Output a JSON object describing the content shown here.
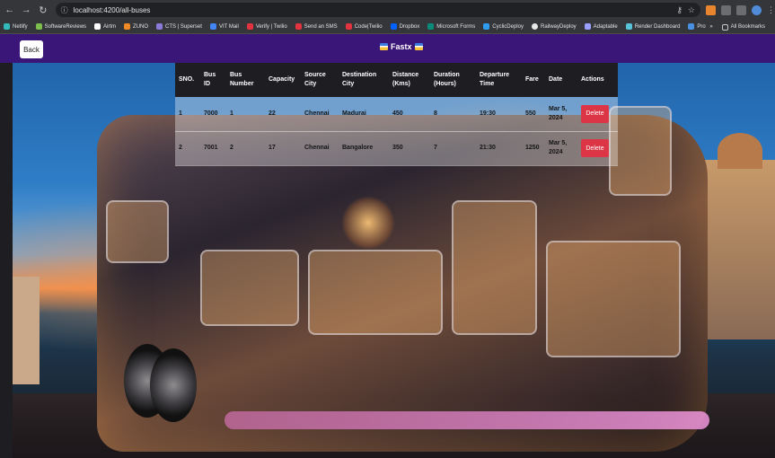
{
  "browser": {
    "url": "localhost:4200/all-buses",
    "bookmarks": [
      "Netlify",
      "SoftwareReviews",
      "Airtm",
      "ZUNO",
      "CTS | Superset",
      "VIT Mail",
      "Verify | Twilio",
      "Send an SMS",
      "Code|Twilio",
      "Dropbox",
      "Microsoft Forms",
      "CyclicDeploy",
      "RailwayDeploy",
      "Adaptable",
      "Render Dashboard",
      "Profile | Mynaukri"
    ],
    "all_bookmarks": "All Bookmarks",
    "more": "»"
  },
  "navbar": {
    "back_label": "Back",
    "brand": "Fastx"
  },
  "table": {
    "headers": [
      "SNO.",
      "Bus ID",
      "Bus Number",
      "Capacity",
      "Source City",
      "Destination City",
      "Distance (Kms)",
      "Duration (Hours)",
      "Departure Time",
      "Fare",
      "Date",
      "Actions"
    ],
    "rows": [
      {
        "sno": "1",
        "bus_id": "7000",
        "bus_number": "1",
        "capacity": "22",
        "source": "Chennai",
        "destination": "Madurai",
        "distance": "450",
        "duration": "8",
        "departure": "19:30",
        "fare": "550",
        "date": "Mar 5, 2024",
        "action": "Delete"
      },
      {
        "sno": "2",
        "bus_id": "7001",
        "bus_number": "2",
        "capacity": "17",
        "source": "Chennai",
        "destination": "Bangalore",
        "distance": "350",
        "duration": "7",
        "departure": "21:30",
        "fare": "1250",
        "date": "Mar 5, 2024",
        "action": "Delete"
      }
    ]
  }
}
